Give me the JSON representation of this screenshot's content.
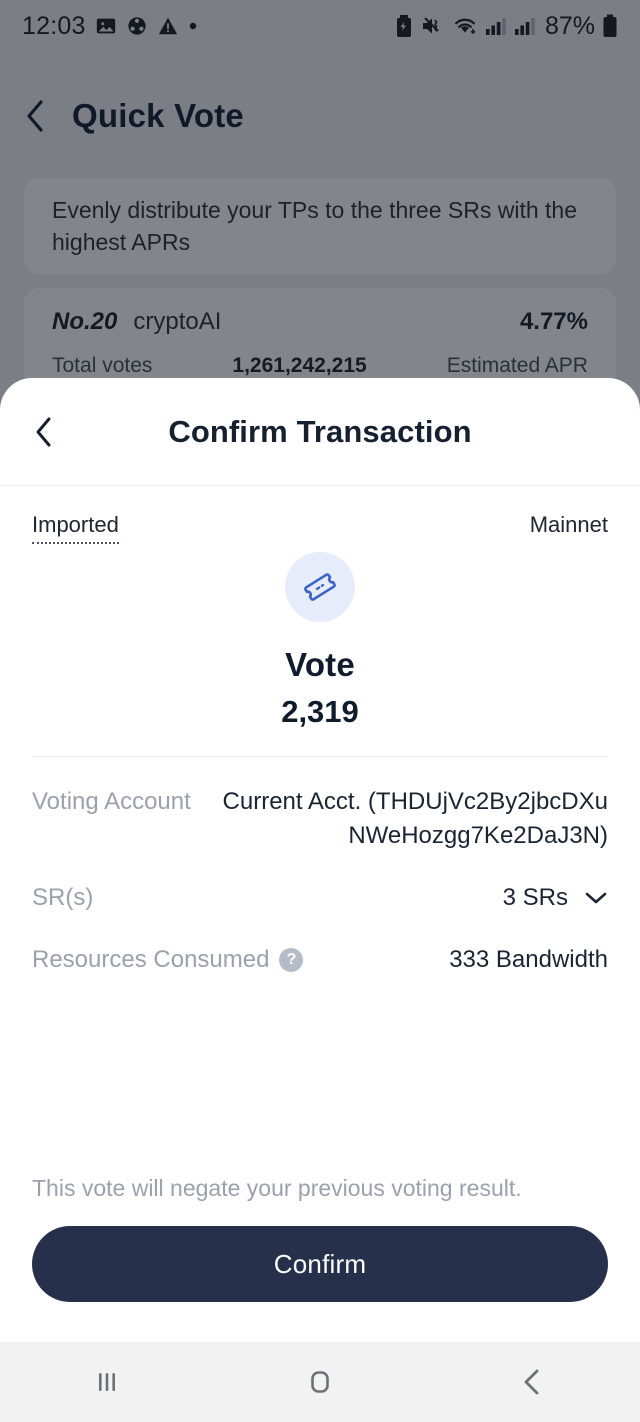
{
  "status_bar": {
    "time": "12:03",
    "battery_percent": "87%",
    "left_icons": [
      "image-icon",
      "share-sync-icon",
      "warning-icon",
      "dot-icon"
    ],
    "right_icons": [
      "battery-saver-icon",
      "mute-vibrate-icon",
      "wifi-icon",
      "signal-bars-icon",
      "signal-bars-2-icon",
      "battery-icon"
    ]
  },
  "background_app": {
    "back_icon": "chevron-left-icon",
    "title": "Quick Vote",
    "hint": "Evenly distribute your TPs to the three SRs with the highest APRs",
    "sr_row": {
      "rank": "No.20",
      "name": "cryptoAI",
      "apr": "4.77%",
      "total_votes_label": "Total votes",
      "total_votes_value": "1,261,242,215",
      "estimated_apr_label": "Estimated APR"
    }
  },
  "sheet": {
    "back_icon": "chevron-left-icon",
    "title": "Confirm Transaction",
    "network": {
      "account_source": "Imported",
      "network_name": "Mainnet"
    },
    "hero": {
      "icon": "ticket-vote-icon",
      "label": "Vote",
      "amount": "2,319"
    },
    "details": [
      {
        "key": "Voting Account",
        "value": "Current Acct. (THDUjVc2By2jbcDXuNWeHozgg7Ke2DaJ3N)",
        "type": "text"
      },
      {
        "key": "SR(s)",
        "value": "3 SRs",
        "type": "expandable",
        "chevron_icon": "chevron-down-icon"
      },
      {
        "key": "Resources Consumed",
        "value": "333 Bandwidth",
        "type": "help",
        "help_icon": "question-mark-icon",
        "help_glyph": "?"
      }
    ],
    "footer": {
      "note": "This vote will negate your previous voting result.",
      "confirm_label": "Confirm"
    }
  },
  "nav_bar": {
    "recents_icon": "recents-icon",
    "home_icon": "home-icon",
    "back_icon": "back-icon"
  },
  "colors": {
    "accent": "#27304a",
    "icon_blue": "#3b62c4",
    "icon_bg": "#e7ecfa",
    "muted": "#9ba1ab",
    "backdrop": "#7b7f85"
  }
}
